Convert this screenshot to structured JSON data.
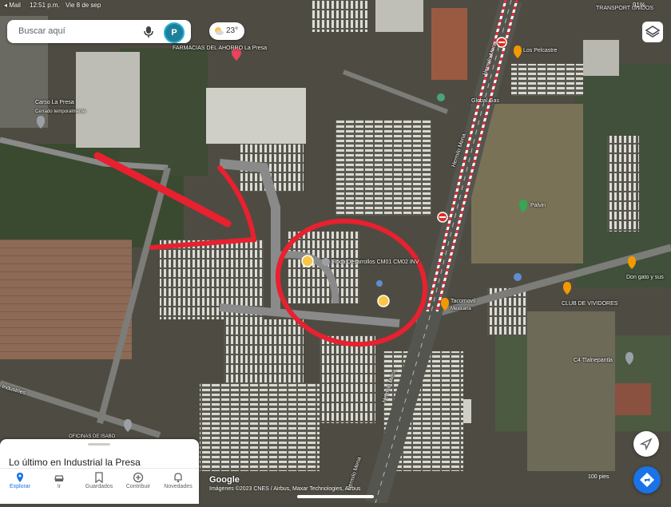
{
  "status_bar": {
    "carrier": "Mail",
    "time": "12:51 p.m.",
    "date": "Vie 8 de sep",
    "battery": "91%"
  },
  "search": {
    "placeholder": "Buscar aquí",
    "avatar_letter": "P"
  },
  "weather": {
    "temperature": "23°",
    "icon": "partly-cloudy-icon"
  },
  "map_labels": {
    "farmacias": "FARMACIAS DEL AHORRO La Presa",
    "carso": "Carso La Presa",
    "carso_status": "Cerrado temporalmente",
    "transport": "TRANSPORT UNIDOS",
    "los_pelcastre": "Los Pelcastre",
    "global_gas": "Global Gas",
    "hermilo_mena_top": "Hermilo Mena",
    "hermilo_mena_mid": "Hermilo Mena",
    "hermilo_mena_low": "Hermilo Mena",
    "hermilo_mena_bottom": "Hermilo Mena",
    "paivin": "Palvin",
    "roca": "Roca Desarrollos CM01 CM02 INV",
    "tacomovil": "Tacomovil",
    "tacomovil_sub": "Mexicana",
    "club": "CLUB DE VIVIDORES",
    "don_gato": "Don gato y sus",
    "c4": "C4 Tlalnepantla",
    "industries": "Industries",
    "oficinas": "OFICINAS DE ISABO"
  },
  "bottom_sheet": {
    "title": "Lo último en Industrial la Presa"
  },
  "nav": [
    {
      "label": "Explorar",
      "icon": "location-pin-icon",
      "active": true
    },
    {
      "label": "Ir",
      "icon": "car-icon",
      "active": false
    },
    {
      "label": "Guardados",
      "icon": "bookmark-icon",
      "active": false
    },
    {
      "label": "Contribuir",
      "icon": "plus-circle-icon",
      "active": false
    },
    {
      "label": "Novedades",
      "icon": "bell-icon",
      "active": false
    }
  ],
  "attribution": {
    "google": "Google",
    "imagery": "Imágenes ©2023 CNES / Airbus, Maxar Technologies, Airbus",
    "scale": "100 pies"
  },
  "colors": {
    "annotation": "#e8202f",
    "road_gray": "#8a8a8a",
    "accent": "#1a73e8"
  }
}
